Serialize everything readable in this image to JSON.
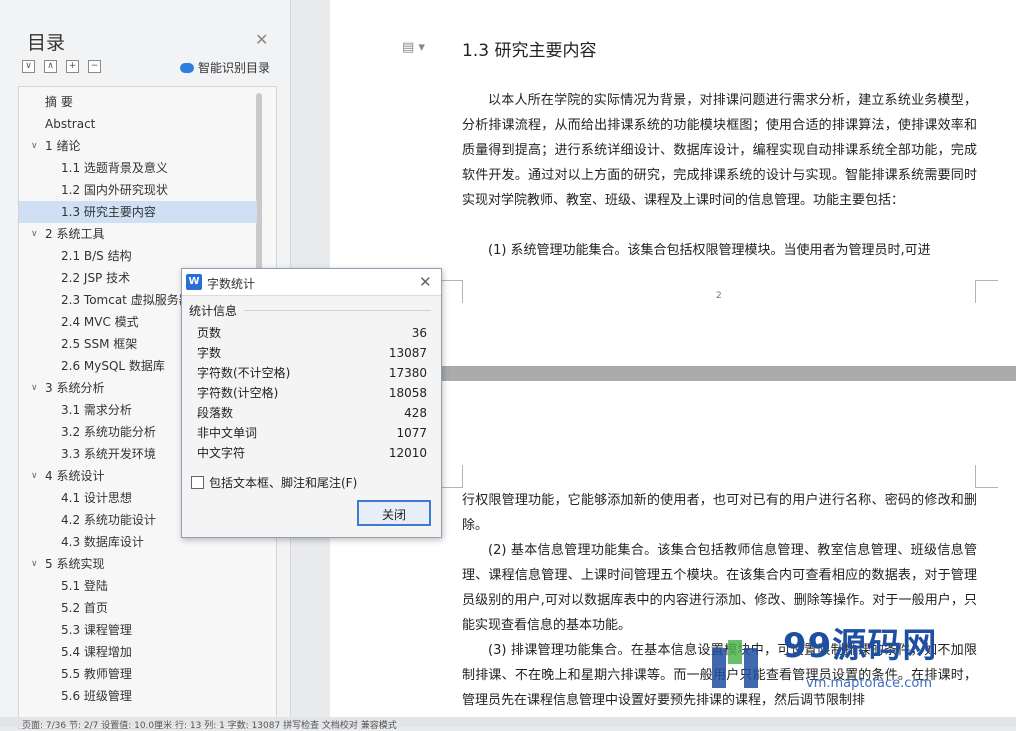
{
  "sidebar": {
    "title": "目录",
    "smart_button": "智能识别目录",
    "items": [
      {
        "label": "摘    要",
        "level": 0,
        "chevron": false,
        "selected": false
      },
      {
        "label": "Abstract",
        "level": 0,
        "chevron": false,
        "selected": false
      },
      {
        "label": "1 绪论",
        "level": 0,
        "chevron": true,
        "selected": false
      },
      {
        "label": "1.1 选题背景及意义",
        "level": 1,
        "chevron": false,
        "selected": false
      },
      {
        "label": "1.2 国内外研究现状",
        "level": 1,
        "chevron": false,
        "selected": false
      },
      {
        "label": "1.3 研究主要内容",
        "level": 1,
        "chevron": false,
        "selected": true
      },
      {
        "label": "2 系统工具",
        "level": 0,
        "chevron": true,
        "selected": false
      },
      {
        "label": "2.1 B/S 结构",
        "level": 1,
        "chevron": false,
        "selected": false
      },
      {
        "label": "2.2 JSP 技术",
        "level": 1,
        "chevron": false,
        "selected": false
      },
      {
        "label": "2.3 Tomcat 虚拟服务器",
        "level": 1,
        "chevron": false,
        "selected": false
      },
      {
        "label": "2.4 MVC 模式",
        "level": 1,
        "chevron": false,
        "selected": false
      },
      {
        "label": "2.5 SSM 框架",
        "level": 1,
        "chevron": false,
        "selected": false
      },
      {
        "label": "2.6 MySQL 数据库",
        "level": 1,
        "chevron": false,
        "selected": false
      },
      {
        "label": "3 系统分析",
        "level": 0,
        "chevron": true,
        "selected": false
      },
      {
        "label": "3.1 需求分析",
        "level": 1,
        "chevron": false,
        "selected": false
      },
      {
        "label": "3.2 系统功能分析",
        "level": 1,
        "chevron": false,
        "selected": false
      },
      {
        "label": "3.3 系统开发环境",
        "level": 1,
        "chevron": false,
        "selected": false
      },
      {
        "label": "4 系统设计",
        "level": 0,
        "chevron": true,
        "selected": false
      },
      {
        "label": "4.1 设计思想",
        "level": 1,
        "chevron": false,
        "selected": false
      },
      {
        "label": "4.2 系统功能设计",
        "level": 1,
        "chevron": false,
        "selected": false
      },
      {
        "label": "4.3 数据库设计",
        "level": 1,
        "chevron": false,
        "selected": false
      },
      {
        "label": "5 系统实现",
        "level": 0,
        "chevron": true,
        "selected": false
      },
      {
        "label": "5.1 登陆",
        "level": 1,
        "chevron": false,
        "selected": false
      },
      {
        "label": "5.2 首页",
        "level": 1,
        "chevron": false,
        "selected": false
      },
      {
        "label": "5.3 课程管理",
        "level": 1,
        "chevron": false,
        "selected": false
      },
      {
        "label": "5.4 课程增加",
        "level": 1,
        "chevron": false,
        "selected": false
      },
      {
        "label": "5.5 教师管理",
        "level": 1,
        "chevron": false,
        "selected": false
      },
      {
        "label": "5.6 班级管理",
        "level": 1,
        "chevron": false,
        "selected": false
      }
    ]
  },
  "document": {
    "heading": "1.3 研究主要内容",
    "page1_paragraphs": [
      "以本人所在学院的实际情况为背景，对排课问题进行需求分析，建立系统业务模型，分析排课流程，从而给出排课系统的功能模块框图；使用合适的排课算法，使排课效率和质量得到提高；进行系统详细设计、数据库设计，编程实现自动排课系统全部功能，完成软件开发。通过对以上方面的研究，完成排课系统的设计与实现。智能排课系统需要同时实现对学院教师、教室、班级、课程及上课时间的信息管理。功能主要包括：",
      "(1) 系统管理功能集合。该集合包括权限管理模块。当使用者为管理员时,可进"
    ],
    "page_number": "2",
    "page2_paragraphs": [
      "行权限管理功能，它能够添加新的使用者，也可对已有的用户进行名称、密码的修改和删除。",
      "(2) 基本信息管理功能集合。该集合包括教师信息管理、教室信息管理、班级信息管理、课程信息管理、上课时间管理五个模块。在该集合内可查看相应的数据表，对于管理员级别的用户,可对以数据库表中的内容进行添加、修改、删除等操作。对于一般用户，只能实现查看信息的基本功能。",
      "(3) 排课管理功能集合。在基本信息设置模块中，可设置限制排课的条件，如不加限制排课、不在晚上和星期六排课等。而一般用户只能查看管理员设置的条件。在排课时，管理员先在课程信息管理中设置好要预先排课的课程，然后调节限制排"
    ]
  },
  "dialog": {
    "title": "字数统计",
    "group_label": "统计信息",
    "stats": [
      {
        "label": "页数",
        "value": "36"
      },
      {
        "label": "字数",
        "value": "13087"
      },
      {
        "label": "字符数(不计空格)",
        "value": "17380"
      },
      {
        "label": "字符数(计空格)",
        "value": "18058"
      },
      {
        "label": "段落数",
        "value": "428"
      },
      {
        "label": "非中文单词",
        "value": "1077"
      },
      {
        "label": "中文字符",
        "value": "12010"
      }
    ],
    "checkbox_label": "包括文本框、脚注和尾注(F)",
    "checkbox_checked": false,
    "close_button": "关闭"
  },
  "watermark": {
    "text": "99源码网",
    "url": "vm.maptoface.com"
  },
  "status_bar": {
    "text": "页面: 7/36    节: 2/7    设置值: 10.0厘米    行: 13    列: 1    字数: 13087    拼写检查    文档校对    兼容模式"
  },
  "colors": {
    "selection": "#cfe0f5",
    "accent": "#2a6fd6",
    "watermark": "#1f4fa0"
  }
}
